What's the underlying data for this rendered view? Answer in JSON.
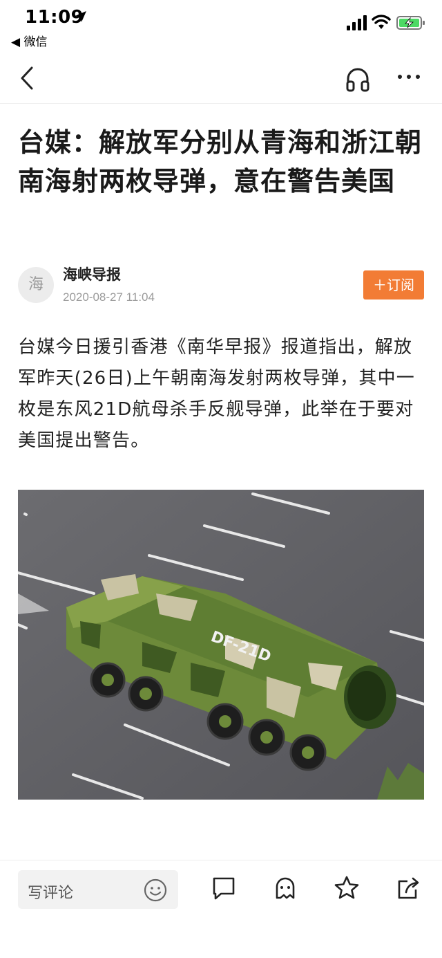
{
  "status_bar": {
    "time": "11:09",
    "back_app": "◀ 微信"
  },
  "nav": {
    "icons": [
      "back-icon",
      "headphone-icon",
      "more-icon"
    ]
  },
  "article": {
    "title": "台媒：解放军分别从青海和浙江朝南海射两枚导弹，意在警告美国",
    "author": {
      "avatar_text": "海",
      "name": "海峡导报",
      "time": "2020-08-27 11:04"
    },
    "subscribe_label": "＋订阅",
    "body": "台媒今日援引香港《南华早报》报道指出，解放军昨天(26日)上午朝南海发射两枚导弹，其中一枚是东风21D航母杀手反舰导弹，此举在于要对美国提出警告。",
    "image": {
      "vehicle_marking": "DF-21D"
    }
  },
  "bottom_bar": {
    "comment_placeholder": "写评论",
    "icons": [
      "smile-icon",
      "comment-icon",
      "like-ghost-icon",
      "star-icon",
      "share-icon"
    ]
  },
  "colors": {
    "accent": "#f27c35",
    "text": "#222222",
    "muted": "#9b9b9b"
  }
}
